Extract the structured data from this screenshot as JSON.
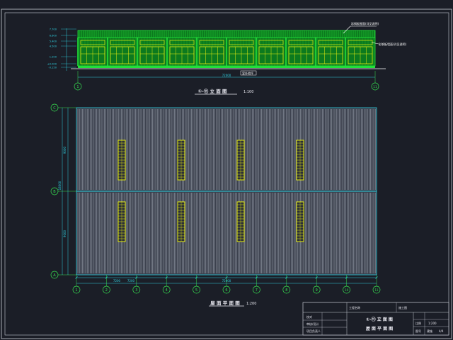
{
  "colors": {
    "background": "#1b1e27",
    "frame": "#c8ccd6",
    "facade_green": "#22e03a",
    "facade_dark": "#0c7a1e",
    "window_yellow": "#e8ef10",
    "roof_sheet": "#9aa0ac",
    "roof_sheet_dark": "#3a3f4c",
    "skylight": "#e8ef10",
    "dimension_cyan": "#2fd0e0",
    "axis_green": "#36e050",
    "title_text": "#e8e8f0"
  },
  "elevation": {
    "title": "①-⑪ 立 面 图",
    "scale": "1:100",
    "total_dimension": "72000",
    "callout_top": "彩钢板屋面(详见说明)",
    "callout_right": "彩钢板墙面(详见说明)",
    "callout_bottom": "室外地坪",
    "level_marks": [
      "7.700",
      "6.600",
      "5.400",
      "4.500",
      "1.200",
      "±0.000",
      "-0.150"
    ],
    "axis_labels": [
      "1",
      "11"
    ],
    "window_count": 10
  },
  "roof_plan": {
    "title": "屋 面 平 面 图",
    "scale": "1:200",
    "total_dimension": "72000",
    "bay_dimensions": [
      "7200",
      "7200"
    ],
    "left_dimensions": [
      "9000",
      "18000",
      "9000"
    ],
    "row_axis_labels": [
      "C",
      "B",
      "A"
    ],
    "column_axis_labels": [
      "1",
      "2",
      "3",
      "4",
      "5",
      "6",
      "7",
      "8",
      "9",
      "10",
      "11"
    ],
    "skylights_per_row": 4
  },
  "title_block": {
    "project_label": "工程名称",
    "design_stage": "施工图",
    "drawing_name_line1": "①-⑪ 立 面 图",
    "drawing_name_line2": "屋 面 平 面 图",
    "scale": "1:200",
    "sheet_label": "图号",
    "sheet_value": "建施",
    "page_value": "4/4",
    "row_labels": [
      "校对",
      "审核/设计",
      "项目负责人"
    ]
  }
}
